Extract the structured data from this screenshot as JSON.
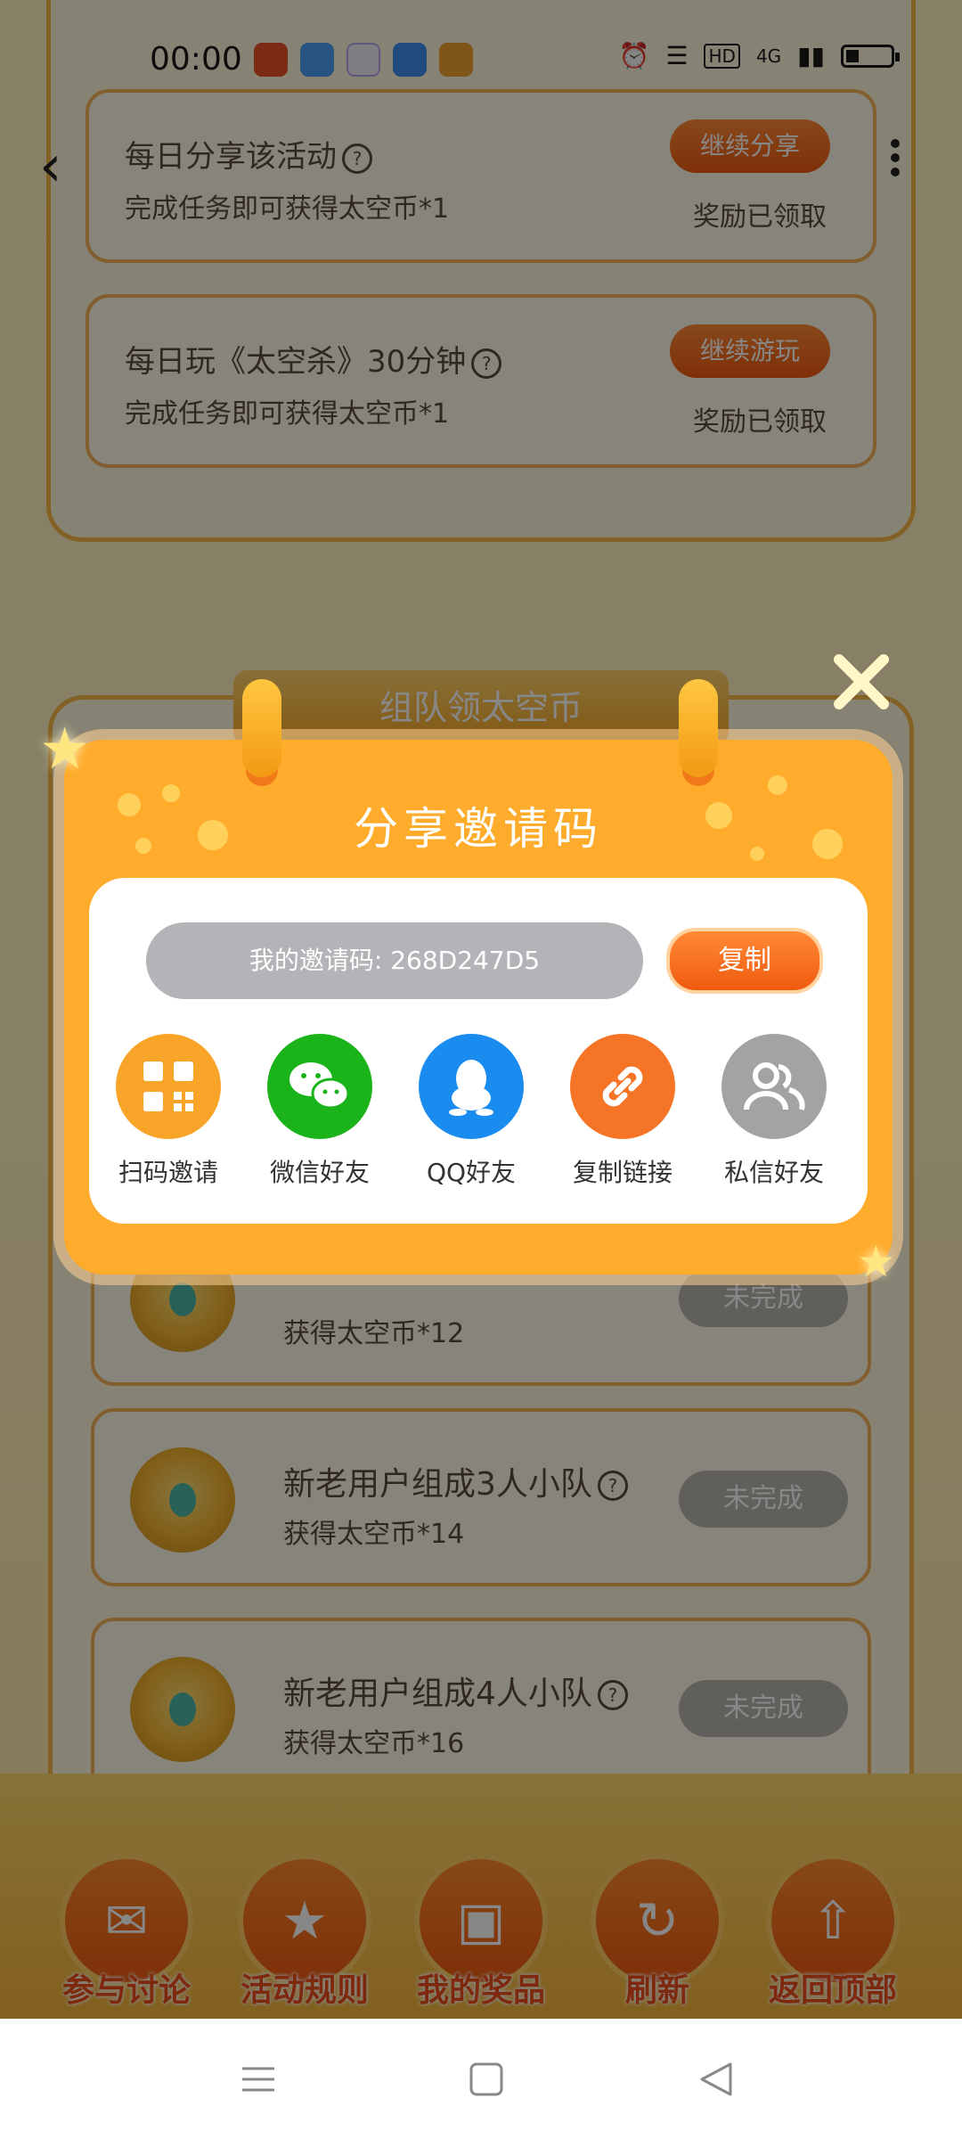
{
  "status_bar": {
    "time": "00:00",
    "network": "4G",
    "hd": "HD"
  },
  "tasks": [
    {
      "title": "每日分享该活动",
      "desc": "完成任务即可获得太空币*1",
      "button": "继续分享",
      "status": "奖励已领取"
    },
    {
      "title": "每日玩《太空杀》30分钟",
      "desc": "完成任务即可获得太空币*1",
      "button": "继续游玩",
      "status": "奖励已领取"
    }
  ],
  "team_section": {
    "title": "组队领太空币",
    "rows": [
      {
        "title": "",
        "desc": "获得太空币*12",
        "button": "未完成"
      },
      {
        "title": "新老用户组成3人小队",
        "desc": "获得太空币*14",
        "button": "未完成"
      },
      {
        "title": "新老用户组成4人小队",
        "desc": "获得太空币*16",
        "button": "未完成"
      }
    ]
  },
  "bottom_bar": [
    {
      "label": "参与讨论",
      "icon": "chat-icon"
    },
    {
      "label": "活动规则",
      "icon": "star-icon"
    },
    {
      "label": "我的奖品",
      "icon": "gift-icon"
    },
    {
      "label": "刷新",
      "icon": "refresh-icon"
    },
    {
      "label": "返回顶部",
      "icon": "upload-icon"
    }
  ],
  "modal": {
    "title": "分享邀请码",
    "invite_code": "我的邀请码: 268D247D5",
    "copy_label": "复制",
    "share_options": [
      {
        "label": "扫码邀请",
        "icon": "qr-code-icon",
        "color": "#f8a428"
      },
      {
        "label": "微信好友",
        "icon": "wechat-icon",
        "color": "#1ab31a"
      },
      {
        "label": "QQ好友",
        "icon": "qq-icon",
        "color": "#1a8cf0"
      },
      {
        "label": "复制链接",
        "icon": "link-icon",
        "color": "#f57426"
      },
      {
        "label": "私信好友",
        "icon": "friends-icon",
        "color": "#a3a3a6"
      }
    ]
  },
  "colors": {
    "accent": "#ffab2b",
    "button_orange": "#f05a0e",
    "disabled": "#b8b4ae"
  }
}
